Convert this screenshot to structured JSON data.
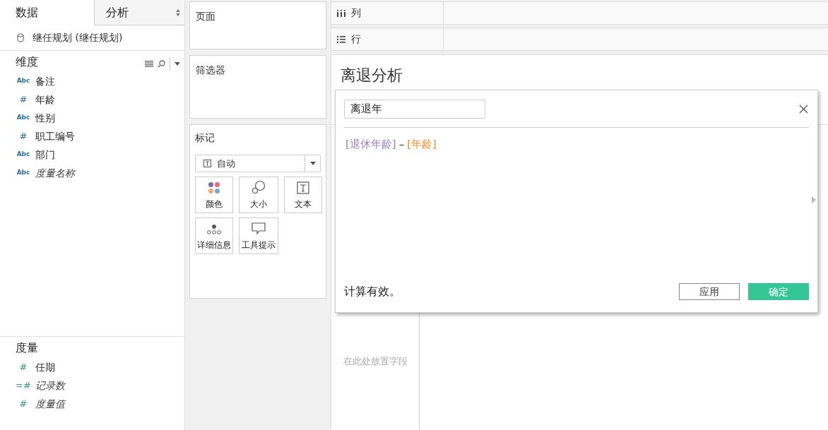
{
  "left_tabs": [
    {
      "label": "数据",
      "selected": true
    },
    {
      "label": "分析",
      "selected": false
    }
  ],
  "data_source": "继任规划 (继任规划)",
  "dimensions": {
    "title": "维度",
    "items": [
      {
        "icon": "Abc",
        "kind": "text",
        "name": "备注",
        "generated": false
      },
      {
        "icon": "#",
        "kind": "number",
        "name": "年龄",
        "generated": false
      },
      {
        "icon": "Abc",
        "kind": "text",
        "name": "性别",
        "generated": false
      },
      {
        "icon": "#",
        "kind": "number",
        "name": "职工编号",
        "generated": false
      },
      {
        "icon": "Abc",
        "kind": "text",
        "name": "部门",
        "generated": false
      },
      {
        "icon": "Abc",
        "kind": "text",
        "name": "度量名称",
        "generated": true
      }
    ]
  },
  "measures": {
    "title": "度量",
    "items": [
      {
        "icon": "#",
        "name": "任期",
        "generated": false
      },
      {
        "icon": "=#",
        "name": "记录数",
        "generated": true
      },
      {
        "icon": "#",
        "name": "度量值",
        "generated": true
      }
    ]
  },
  "pages_card": {
    "title": "页面"
  },
  "filters_card": {
    "title": "筛选器"
  },
  "marks_card": {
    "title": "标记",
    "mark_type": "自动",
    "buttons": [
      {
        "kind": "color",
        "label": "颜色"
      },
      {
        "kind": "size",
        "label": "大小"
      },
      {
        "kind": "text",
        "label": "文本"
      },
      {
        "kind": "detail",
        "label": "详细信息"
      },
      {
        "kind": "tooltip",
        "label": "工具提示"
      }
    ]
  },
  "shelves": [
    {
      "kind": "columns",
      "label": "列"
    },
    {
      "kind": "rows",
      "label": "行"
    }
  ],
  "view": {
    "title": "离退分析",
    "drop_hint": "在此处放置字段"
  },
  "calc_dialog": {
    "name": "离退年",
    "formula": [
      {
        "kind": "field",
        "text": "[退休年龄]",
        "color": "#9a7fc4"
      },
      {
        "kind": "operator",
        "text": "–"
      },
      {
        "kind": "field",
        "text": "[年龄]",
        "color": "#f28e2b"
      }
    ],
    "status": "计算有效。",
    "buttons": [
      {
        "kind": "secondary",
        "label": "应用"
      },
      {
        "kind": "primary",
        "label": "确定"
      }
    ]
  }
}
